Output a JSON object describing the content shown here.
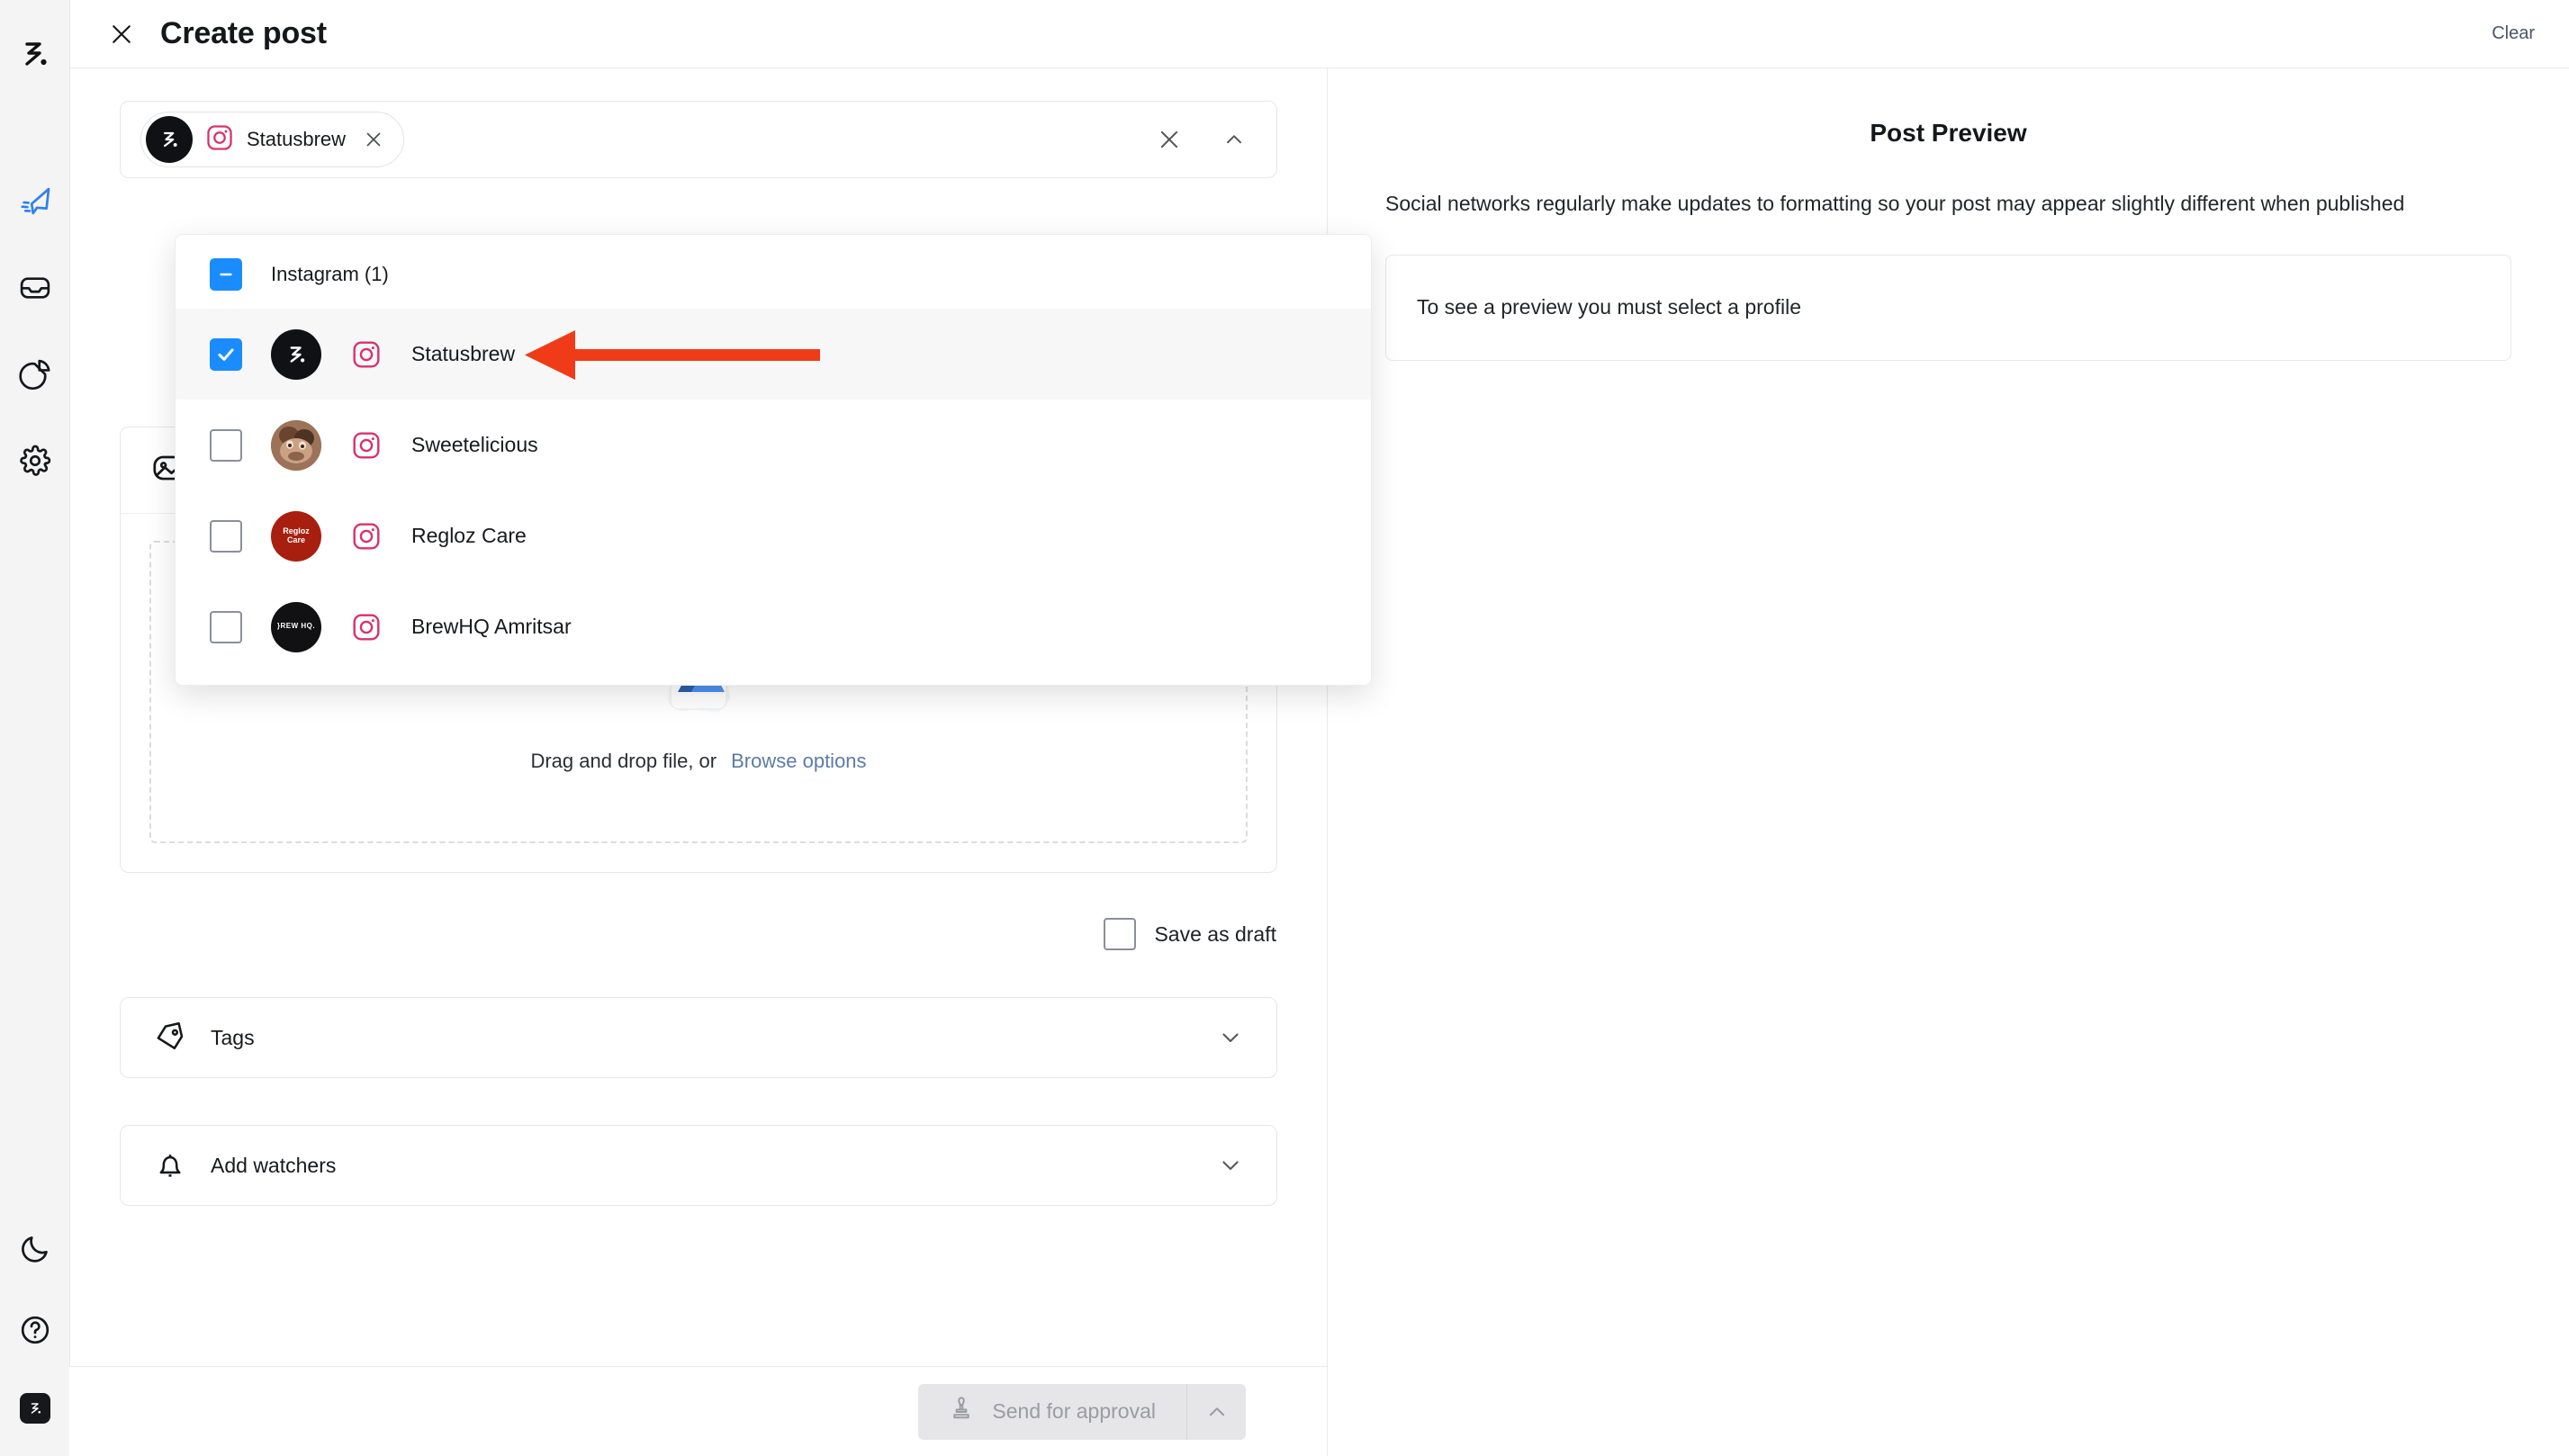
{
  "sidebar": {
    "logo_name": "statusbrew-logo",
    "items": [
      {
        "name": "publish-icon",
        "label": "Publish",
        "active": true
      },
      {
        "name": "inbox-icon",
        "label": "Inbox",
        "active": false
      },
      {
        "name": "analytics-icon",
        "label": "Analytics",
        "active": false
      },
      {
        "name": "settings-icon",
        "label": "Settings",
        "active": false
      }
    ],
    "bottom": [
      {
        "name": "dark-mode-icon",
        "label": "Dark mode"
      },
      {
        "name": "help-icon",
        "label": "Help"
      }
    ],
    "avatar_label": "Statusbrew"
  },
  "header": {
    "close_label": "Close",
    "title": "Create post",
    "clear_label": "Clear"
  },
  "profile_selector": {
    "chip": {
      "name": "Statusbrew",
      "network": "instagram",
      "remove_label": "Remove"
    },
    "clear_all_label": "Clear all",
    "collapse_label": "Collapse",
    "dropdown": {
      "group_label": "Instagram (1)",
      "group_state": "indeterminate",
      "profiles": [
        {
          "name": "Statusbrew",
          "network": "instagram",
          "checked": true,
          "avatar": "statusbrew"
        },
        {
          "name": "Sweetelicious",
          "network": "instagram",
          "checked": false,
          "avatar": "sweetelicious"
        },
        {
          "name": "Regloz Care",
          "network": "instagram",
          "checked": false,
          "avatar": "regloz",
          "avatar_text": "Regloz\nCare"
        },
        {
          "name": "BrewHQ Amritsar",
          "network": "instagram",
          "checked": false,
          "avatar": "brewhq",
          "avatar_text": "BREW HQ"
        }
      ]
    }
  },
  "media": {
    "section_label": "Media",
    "dropzone_text": "Drag and drop file, or",
    "browse_label": "Browse options"
  },
  "draft": {
    "label": "Save as draft",
    "checked": false
  },
  "accordions": [
    {
      "icon": "tag-icon",
      "label": "Tags",
      "expanded": false
    },
    {
      "icon": "bell-icon",
      "label": "Add watchers",
      "expanded": false
    }
  ],
  "footer": {
    "send_label": "Send for approval",
    "send_disabled": true,
    "dropdown_label": "More send options"
  },
  "preview": {
    "title": "Post Preview",
    "note": "Social networks regularly make updates to formatting so your post may appear slightly different when published",
    "empty_text": "To see a preview you must select a profile"
  },
  "annotation": {
    "type": "arrow",
    "direction": "left",
    "color": "#F03B18",
    "points_at": "Statusbrew"
  },
  "colors": {
    "accent_blue": "#1a8cff",
    "instagram_pink": "#D6336C",
    "publish_blue": "#2F80ED",
    "annotation_red": "#F03B18",
    "rail_bg": "#f4f4f5"
  }
}
